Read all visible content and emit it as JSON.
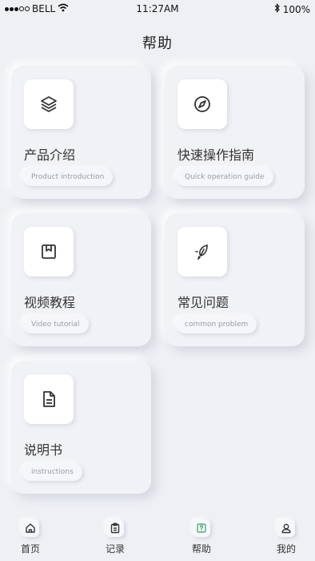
{
  "status_bar": {
    "carrier": "BELL",
    "time": "11:27AM",
    "battery": "100%",
    "icons": [
      "signal-dots-icon",
      "wifi-icon",
      "bluetooth-icon"
    ]
  },
  "header": {
    "title": "帮助"
  },
  "cards": [
    {
      "title": "产品介绍",
      "subtitle": "Product introduction",
      "icon": "layers-icon"
    },
    {
      "title": "快速操作指南",
      "subtitle": "Quick operation guide",
      "icon": "compass-icon"
    },
    {
      "title": "视频教程",
      "subtitle": "Video tutorial",
      "icon": "bookmark-icon"
    },
    {
      "title": "常见问题",
      "subtitle": "common problem",
      "icon": "leaf-icon"
    },
    {
      "title": "说明书",
      "subtitle": "instructions",
      "icon": "document-icon"
    }
  ],
  "tabbar": {
    "items": [
      {
        "label": "首页",
        "icon": "home-icon"
      },
      {
        "label": "记录",
        "icon": "clipboard-icon"
      },
      {
        "label": "帮助",
        "icon": "help-icon",
        "active": true
      },
      {
        "label": "我的",
        "icon": "user-icon"
      }
    ],
    "active_color": "#4caf7a"
  }
}
